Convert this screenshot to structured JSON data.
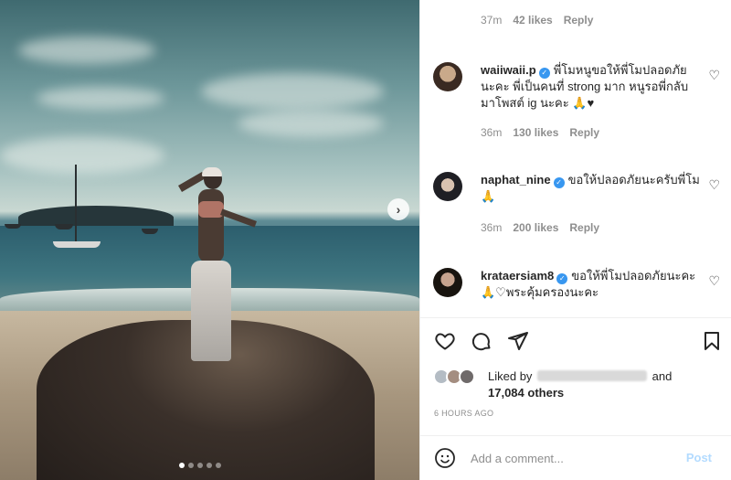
{
  "post": {
    "image_alt": "Woman standing on rocks at a beach with sailboats and sea",
    "carousel": {
      "count": 5,
      "active_index": 0
    },
    "next_icon": "chevron-right-icon"
  },
  "top_comment_meta": {
    "time": "37m",
    "likes": "42 likes",
    "reply": "Reply"
  },
  "comments": [
    {
      "username": "waiiwaii.p",
      "verified": true,
      "text": "พี่โมหนูขอให้พี่โมปลอดภัยนะคะ พี่เป็นคนที่ strong มาก หนูรอพี่กลับมาโพสต์ ig นะคะ 🙏♥",
      "time": "36m",
      "likes": "130 likes",
      "reply": "Reply"
    },
    {
      "username": "naphat_nine",
      "verified": true,
      "text": "ขอให้ปลอดภัยนะครับพี่โม🙏",
      "time": "36m",
      "likes": "200 likes",
      "reply": "Reply"
    },
    {
      "username": "krataersiam8",
      "verified": true,
      "text": "ขอให้พี่โมปลอดภัยนะคะ🙏♡พระคุ้มครองนะคะ"
    }
  ],
  "actions": {
    "like_icon": "heart-outline-icon",
    "comment_icon": "comment-bubble-icon",
    "share_icon": "paper-plane-icon",
    "save_icon": "bookmark-icon"
  },
  "likes_summary": {
    "prefix": "Liked by",
    "middle": "and",
    "others": "17,084 others"
  },
  "timestamp": "6 HOURS AGO",
  "add_comment": {
    "placeholder": "Add a comment...",
    "post_label": "Post",
    "emoji_icon": "emoji-smile-icon"
  },
  "colors": {
    "verified": "#3897f0",
    "post_disabled": "#b3dbff",
    "muted": "#8e8e8e"
  }
}
